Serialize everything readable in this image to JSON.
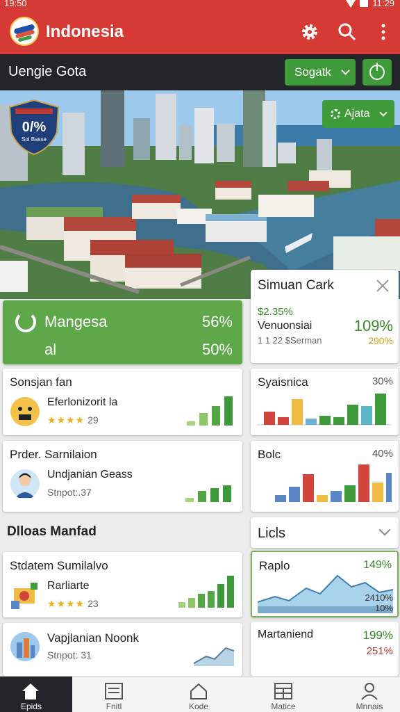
{
  "status": {
    "time": "19:50",
    "right_time": "11:29"
  },
  "app": {
    "title": "Indonesia"
  },
  "subbar": {
    "title": "Uengie Gota",
    "select_label": "Sogatk"
  },
  "hero": {
    "shield_value": "0/%",
    "shield_sub": "Sol Basse",
    "data_button": "Ajata"
  },
  "summary": {
    "label1": "Mangesa",
    "label2": "al",
    "value1": "56%",
    "value2": "50%"
  },
  "sim": {
    "title": "Simuan Cark",
    "amount": "$2.35%",
    "name": "Venuonsiai",
    "sub": "1 1 22 $Serman",
    "pct1": "109%",
    "pct2": "290%"
  },
  "cards": [
    {
      "title": "Sonsjan fan",
      "name": "Eferlonizorit la",
      "stars": "★★★★",
      "meta": "29"
    },
    {
      "title": "Syaisnica",
      "value": "30%"
    },
    {
      "title": "Prder. Sarnilaion",
      "name": "Undjanian Geass",
      "meta": "Stnpot:.37"
    },
    {
      "title": "Bolc",
      "value": "40%"
    },
    {
      "title": "Stdatem Sumilalvo",
      "name": "Rarliarte",
      "stars": "★★★★",
      "meta": "23"
    },
    {
      "title": "Raplo",
      "pct1": "149%",
      "pct2": "2410%",
      "pct3": "10%"
    },
    {
      "title": "Vapjlanian Noonk",
      "meta": "Stnpot: 31"
    },
    {
      "title": "Martaniend",
      "pct1": "199%",
      "pct2": "251%"
    }
  ],
  "sections": {
    "left": "Dlloas Manfad",
    "right": "Licls"
  },
  "nav": [
    {
      "label": "Epids"
    },
    {
      "label": "Fnitl"
    },
    {
      "label": "Kode"
    },
    {
      "label": "Matice"
    },
    {
      "label": "Mnnais"
    }
  ],
  "colors": {
    "brand": "#d63a34",
    "accent": "#3f9a3a",
    "dark": "#23252b"
  }
}
